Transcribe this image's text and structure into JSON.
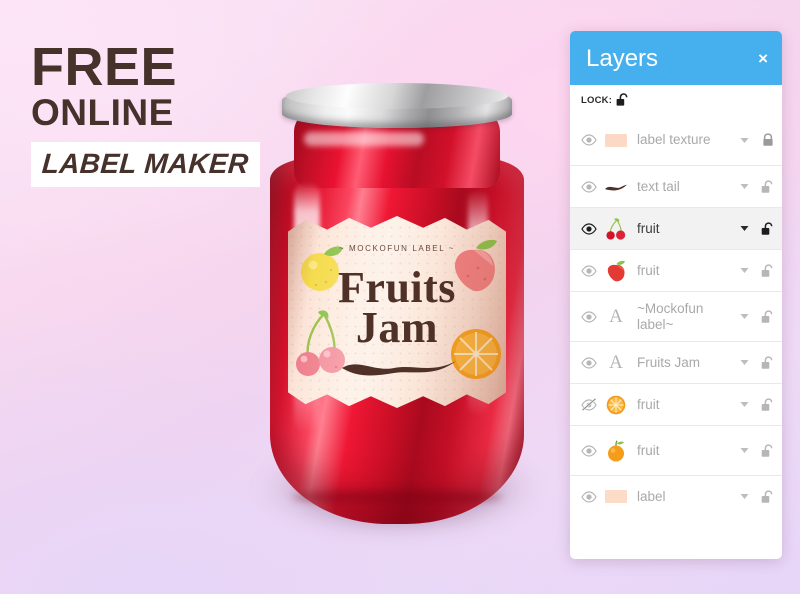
{
  "promo": {
    "line1": "FREE",
    "line2": "ONLINE",
    "banner": "LABEL MAKER",
    "text_color": "#46312b",
    "banner_bg": "#ffffff"
  },
  "jar": {
    "label": {
      "kicker": "~ MOCKOFUN LABEL ~",
      "title_line1": "Fruits",
      "title_line2": "Jam",
      "paper_color": "#fdeade",
      "ink_color": "#4f3128",
      "fruits": [
        "lemon",
        "apple",
        "cherries",
        "orange-slice"
      ]
    },
    "jam_color": "#e2112d",
    "lid_color": "#c6c6c7"
  },
  "panel": {
    "title": "Layers",
    "close_label": "×",
    "header_color": "#45b0ed",
    "lock_bar": {
      "label": "LOCK:",
      "state": "unlocked"
    },
    "selected_index": 2,
    "layers": [
      {
        "name": "label texture",
        "thumb": "swatch-peach",
        "thumb_color": "#fbd9c4",
        "visible": true,
        "locked": true,
        "selected": false,
        "wraps": true
      },
      {
        "name": "text tail",
        "thumb": "swash-stroke",
        "thumb_color": "#4f3128",
        "visible": true,
        "locked": false,
        "selected": false,
        "wraps": false
      },
      {
        "name": "fruit",
        "thumb": "cherries",
        "thumb_color": "#d8243a",
        "visible": true,
        "locked": false,
        "selected": true,
        "wraps": false
      },
      {
        "name": "fruit",
        "thumb": "apple",
        "thumb_color": "#e23b33",
        "visible": true,
        "locked": false,
        "selected": false,
        "wraps": false
      },
      {
        "name": "~Mockofun label~",
        "thumb": "text-glyph-A",
        "thumb_color": "#b4b4b4",
        "visible": true,
        "locked": false,
        "selected": false,
        "wraps": true
      },
      {
        "name": "Fruits Jam",
        "thumb": "text-glyph-A",
        "thumb_color": "#b4b4b4",
        "visible": true,
        "locked": false,
        "selected": false,
        "wraps": false
      },
      {
        "name": "fruit",
        "thumb": "orange-slice",
        "thumb_color": "#f5a623",
        "visible": false,
        "locked": false,
        "selected": false,
        "wraps": false
      },
      {
        "name": "fruit",
        "thumb": "orange-whole",
        "thumb_color": "#f59c1a",
        "visible": true,
        "locked": false,
        "selected": false,
        "wraps": true
      },
      {
        "name": "label",
        "thumb": "swatch-peach",
        "thumb_color": "#fcdcc6",
        "visible": true,
        "locked": false,
        "selected": false,
        "wraps": false
      }
    ]
  },
  "background": {
    "top_left": "#fbe4f6",
    "top_right": "#ffd6f0",
    "bottom_left": "#e7d6f8",
    "bottom_right": "#f3d3ee"
  }
}
